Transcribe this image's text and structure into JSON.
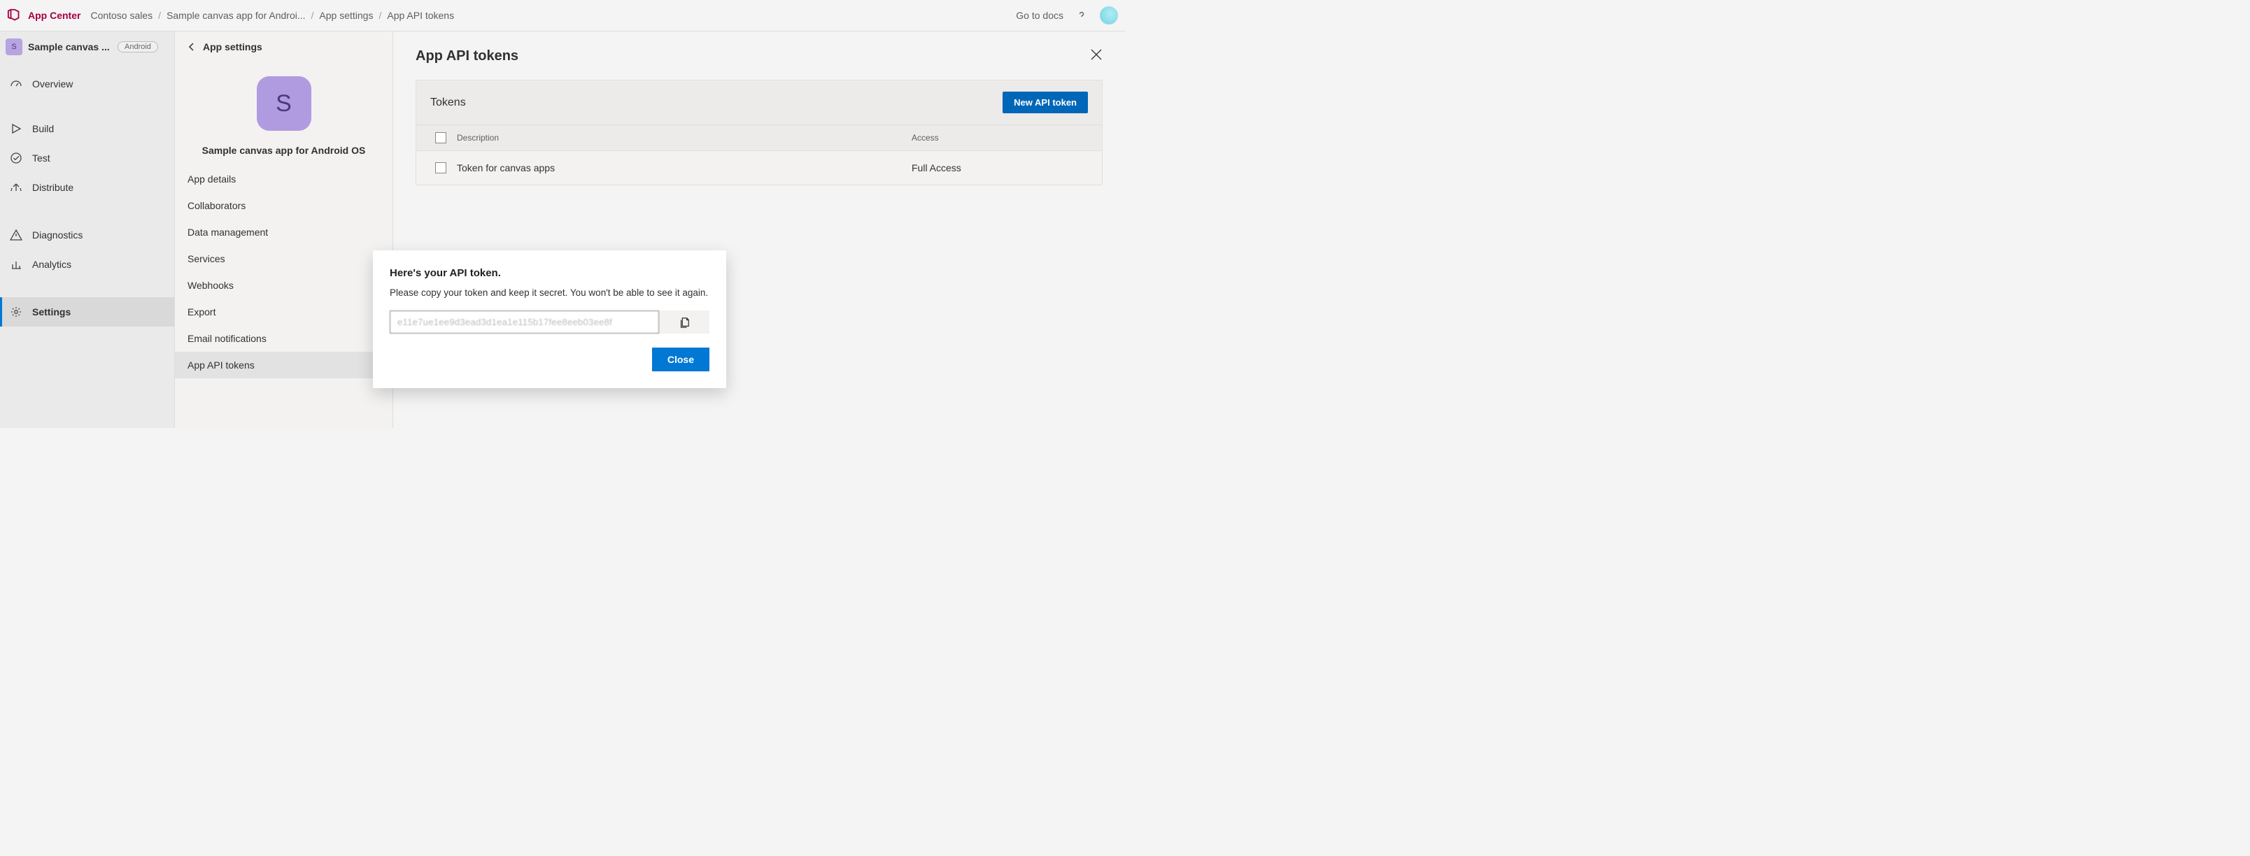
{
  "header": {
    "brand": "App Center",
    "breadcrumb": [
      "Contoso sales",
      "Sample canvas app for Androi...",
      "App settings",
      "App API tokens"
    ],
    "go_to_docs": "Go to docs"
  },
  "sidebar": {
    "app_title_short": "Sample canvas ...",
    "app_icon_letter": "S",
    "platform_badge": "Android",
    "items": [
      {
        "label": "Overview"
      },
      {
        "label": "Build"
      },
      {
        "label": "Test"
      },
      {
        "label": "Distribute"
      },
      {
        "label": "Diagnostics"
      },
      {
        "label": "Analytics"
      },
      {
        "label": "Settings"
      }
    ]
  },
  "settings_col": {
    "back_label": "App settings",
    "app_icon_letter": "S",
    "app_name": "Sample canvas app for Android OS",
    "items": [
      "App details",
      "Collaborators",
      "Data management",
      "Services",
      "Webhooks",
      "Export",
      "Email notifications",
      "App API tokens"
    ]
  },
  "main": {
    "title": "App API tokens",
    "tokens": {
      "title": "Tokens",
      "new_btn": "New API token",
      "col_description": "Description",
      "col_access": "Access",
      "rows": [
        {
          "description": "Token for canvas apps",
          "access": "Full Access"
        }
      ]
    }
  },
  "modal": {
    "title": "Here's your API token.",
    "subtitle": "Please copy your token and keep it secret. You won't be able to see it again.",
    "token_value": "e11e7ue1ee9d3ead3d1ea1e115b17fee8eeb03ee8f",
    "close": "Close"
  }
}
